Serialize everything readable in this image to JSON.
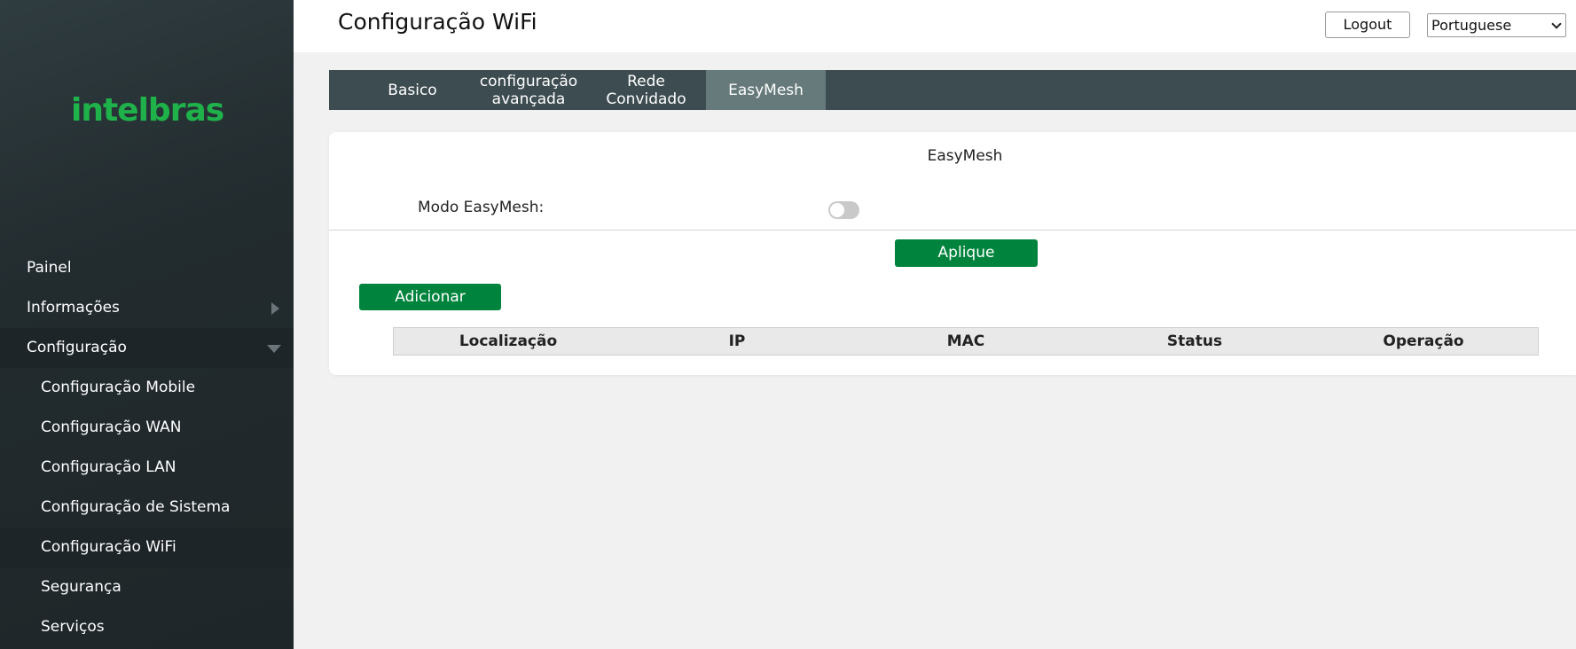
{
  "sidebar": {
    "logo": "intelbras",
    "items": [
      {
        "label": "Painel"
      },
      {
        "label": "Informações"
      },
      {
        "label": "Configuração"
      },
      {
        "label": "Configuração Mobile"
      },
      {
        "label": "Configuração WAN"
      },
      {
        "label": "Configuração LAN"
      },
      {
        "label": "Configuração de Sistema"
      },
      {
        "label": "Configuração WiFi"
      },
      {
        "label": "Segurança"
      },
      {
        "label": "Serviços"
      }
    ]
  },
  "header": {
    "title": "Configuração WiFi",
    "logout_label": "Logout",
    "language": "Portuguese"
  },
  "tabs": [
    {
      "label": "Basico"
    },
    {
      "label": "configuração avançada"
    },
    {
      "label": "Rede Convidado"
    },
    {
      "label": "EasyMesh"
    }
  ],
  "main": {
    "section_title": "EasyMesh",
    "mode_label": "Modo EasyMesh:",
    "mode_enabled": false,
    "apply_label": "Aplique",
    "add_label": "Adicionar",
    "table_headers": [
      "Localização",
      "IP",
      "MAC",
      "Status",
      "Operação"
    ]
  },
  "colors": {
    "accent": "#00843d",
    "brand": "#1fb24a",
    "sidebar_bg": "#263033",
    "tab_bar_bg": "#3d4c51",
    "tab_active_bg": "#667a7b"
  },
  "icons": [
    "chevron-right-icon",
    "chevron-down-icon",
    "select-chevron-icon"
  ]
}
